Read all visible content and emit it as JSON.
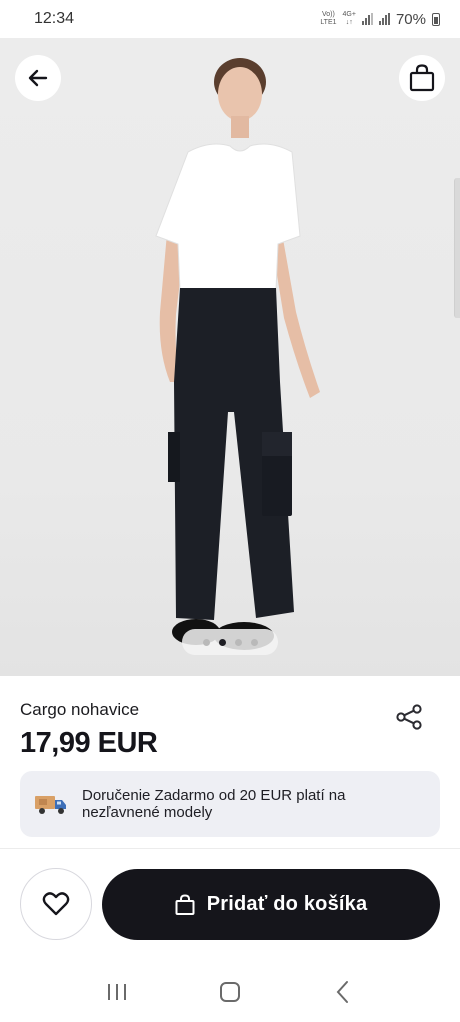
{
  "status_bar": {
    "time": "12:34",
    "network_top": "Vo))",
    "network_bottom": "LTE1",
    "network_type": "4G+",
    "battery": "70%"
  },
  "gallery": {
    "image_count": 4,
    "active_index": 1,
    "background_color": "#ebebeb"
  },
  "product": {
    "name": "Cargo nohavice",
    "price": "17,99 EUR"
  },
  "delivery": {
    "text": "Doručenie Zadarmo od 20 EUR platí na nezľavnené modely",
    "icon": "delivery-truck-icon"
  },
  "actions": {
    "add_to_cart_label": "Pridať do košíka",
    "favorite_icon": "heart-icon",
    "cart_icon": "shopping-bag-icon"
  },
  "colors": {
    "primary_dark": "#15151b",
    "banner_bg": "#eeeff4",
    "text": "#1b1b1f"
  }
}
